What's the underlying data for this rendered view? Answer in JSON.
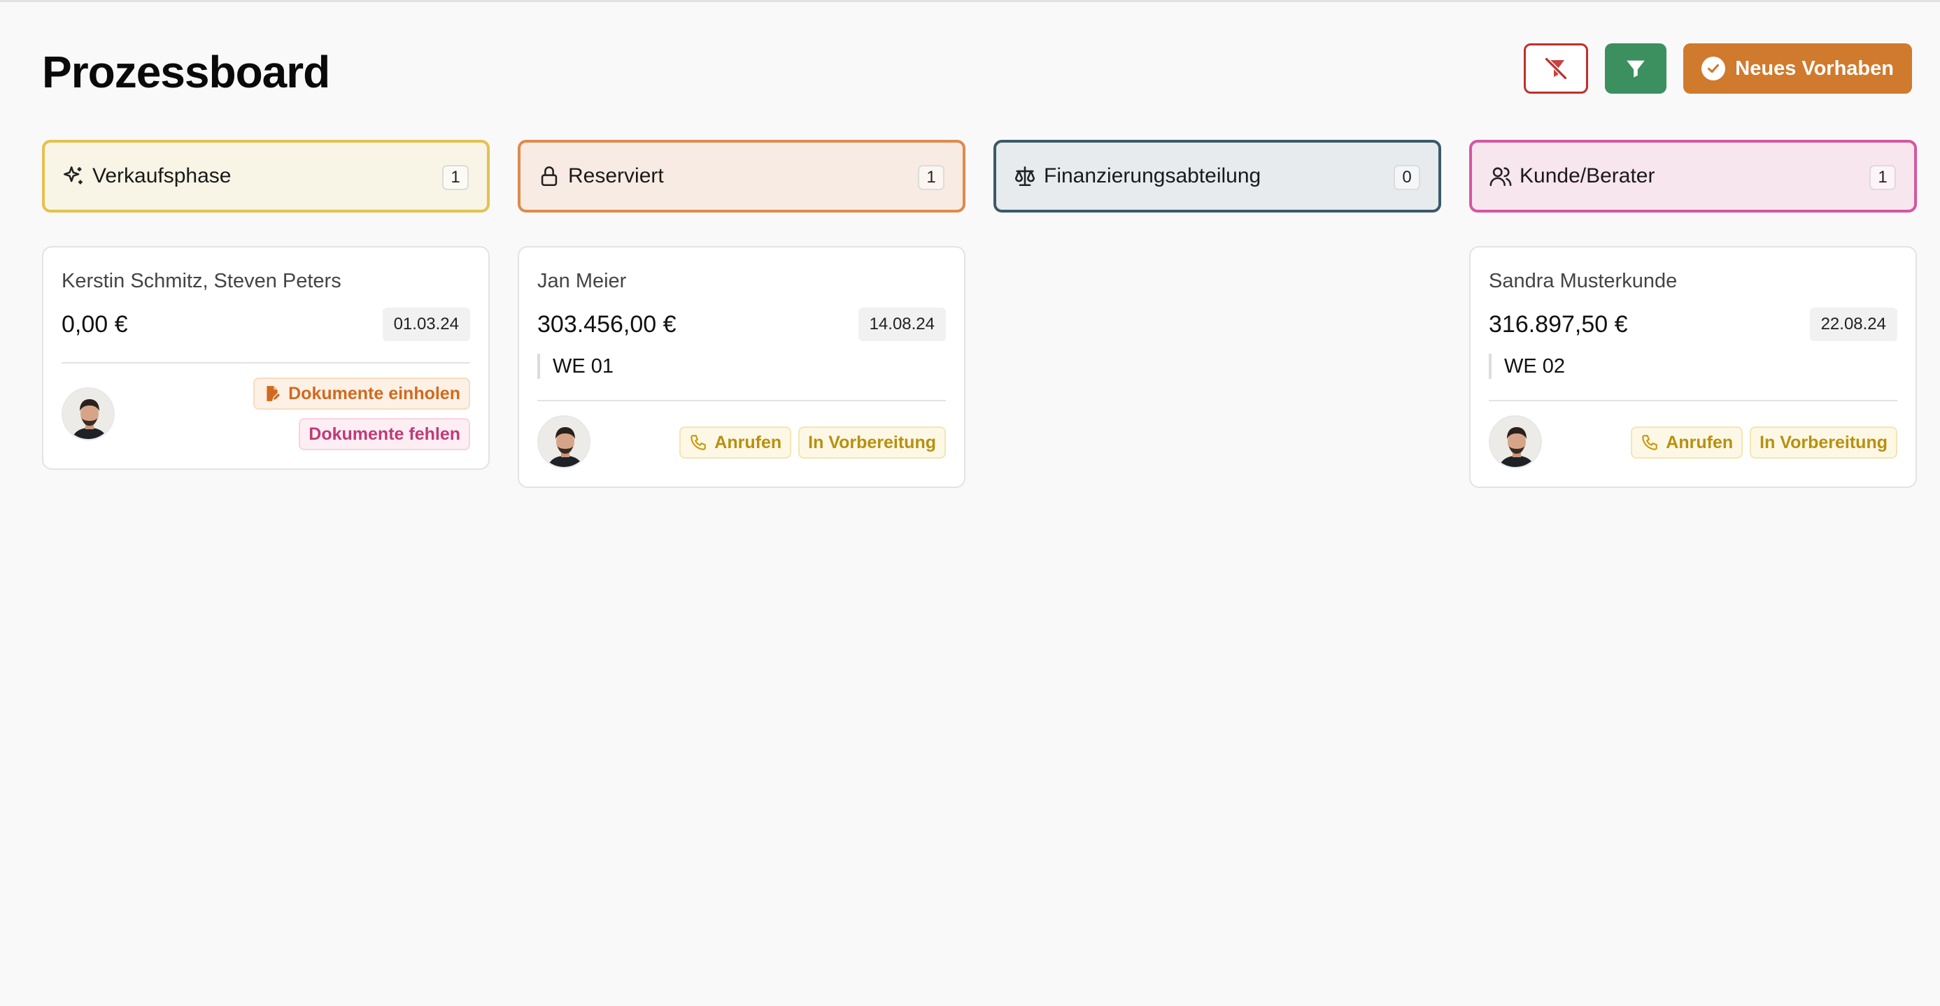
{
  "page": {
    "title": "Prozessboard"
  },
  "toolbar": {
    "clear_filter_icon": "filter-off-icon",
    "filter_icon": "filter-icon",
    "new_label": "Neues Vorhaben",
    "colors": {
      "clear": "#c0302c",
      "filter": "#3c8f5f",
      "new": "#d07a2e"
    }
  },
  "columns": [
    {
      "title": "Verkaufsphase",
      "count": "1",
      "icon": "sparkles-icon",
      "colors": {
        "border": "#e5c14d",
        "bg": "#f8f4e6"
      },
      "cards": [
        {
          "name": "Kerstin Schmitz, Steven Peters",
          "amount": "0,00 €",
          "date": "01.03.24",
          "tags": [
            "Dokumente einholen",
            "Dokumente fehlen"
          ]
        }
      ]
    },
    {
      "title": "Reserviert",
      "count": "1",
      "icon": "lock-icon",
      "colors": {
        "border": "#e08a4a",
        "bg": "#f8ebe3"
      },
      "cards": [
        {
          "name": "Jan Meier",
          "amount": "303.456,00 €",
          "date": "14.08.24",
          "unit": "WE 01",
          "tags": [
            "Anrufen",
            "In Vorbereitung"
          ]
        }
      ]
    },
    {
      "title": "Finanzierungsabteilung",
      "count": "0",
      "icon": "scale-icon",
      "colors": {
        "border": "#3c5a68",
        "bg": "#e7ebed"
      },
      "cards": []
    },
    {
      "title": "Kunde/Berater",
      "count": "1",
      "icon": "users-icon",
      "colors": {
        "border": "#d557a0",
        "bg": "#f8e6ef"
      },
      "cards": [
        {
          "name": "Sandra Musterkunde",
          "amount": "316.897,50 €",
          "date": "22.08.24",
          "unit": "WE 02",
          "tags": [
            "Anrufen",
            "In Vorbereitung"
          ]
        }
      ]
    }
  ]
}
